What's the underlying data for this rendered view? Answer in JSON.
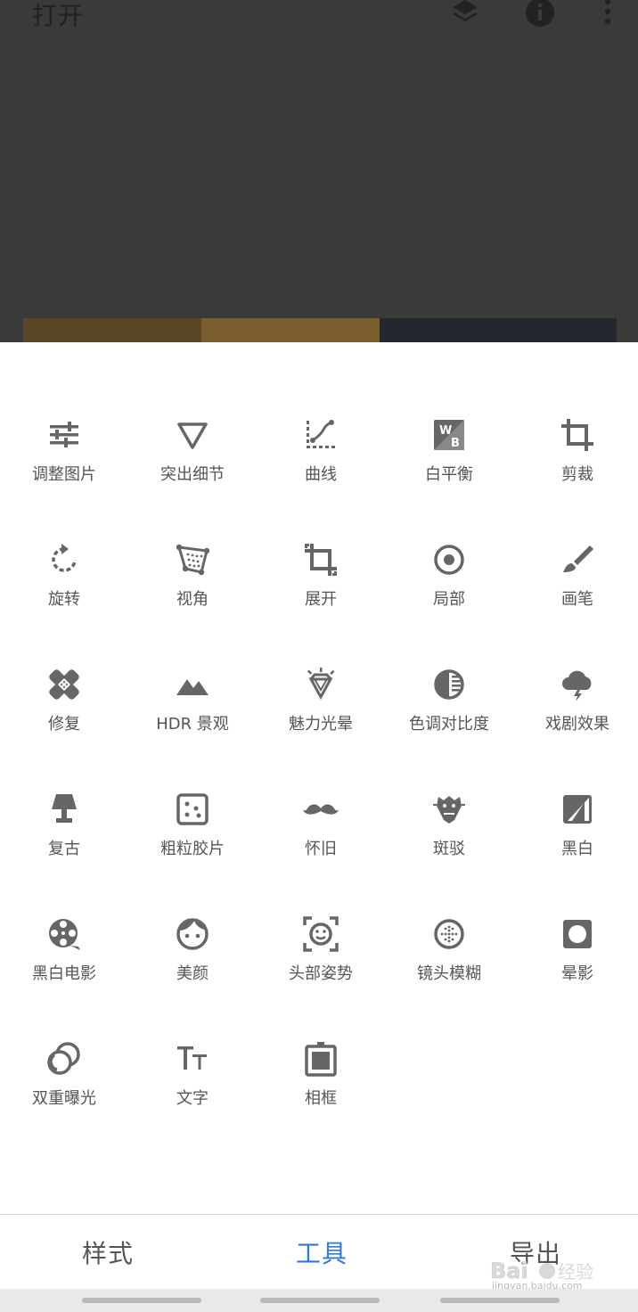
{
  "header": {
    "open_label": "打开"
  },
  "tools": [
    {
      "label": "调整图片",
      "icon": "tune-icon"
    },
    {
      "label": "突出细节",
      "icon": "details-triangle-icon"
    },
    {
      "label": "曲线",
      "icon": "curves-icon"
    },
    {
      "label": "白平衡",
      "icon": "white-balance-icon"
    },
    {
      "label": "剪裁",
      "icon": "crop-icon"
    },
    {
      "label": "旋转",
      "icon": "rotate-icon"
    },
    {
      "label": "视角",
      "icon": "perspective-icon"
    },
    {
      "label": "展开",
      "icon": "expand-icon"
    },
    {
      "label": "局部",
      "icon": "selective-icon"
    },
    {
      "label": "画笔",
      "icon": "brush-icon"
    },
    {
      "label": "修复",
      "icon": "healing-icon"
    },
    {
      "label": "HDR 景观",
      "icon": "hdr-mountain-icon"
    },
    {
      "label": "魅力光晕",
      "icon": "glamour-glow-diamond-icon"
    },
    {
      "label": "色调对比度",
      "icon": "tonal-contrast-icon"
    },
    {
      "label": "戏剧效果",
      "icon": "drama-cloud-icon"
    },
    {
      "label": "复古",
      "icon": "vintage-lamp-icon"
    },
    {
      "label": "粗粒胶片",
      "icon": "grainy-film-icon"
    },
    {
      "label": "怀旧",
      "icon": "mustache-icon"
    },
    {
      "label": "斑驳",
      "icon": "grunge-icon"
    },
    {
      "label": "黑白",
      "icon": "black-white-icon"
    },
    {
      "label": "黑白电影",
      "icon": "film-reel-icon"
    },
    {
      "label": "美颜",
      "icon": "face-icon"
    },
    {
      "label": "头部姿势",
      "icon": "head-pose-icon"
    },
    {
      "label": "镜头模糊",
      "icon": "lens-blur-icon"
    },
    {
      "label": "晕影",
      "icon": "vignette-icon"
    },
    {
      "label": "双重曝光",
      "icon": "double-exposure-icon"
    },
    {
      "label": "文字",
      "icon": "text-icon"
    },
    {
      "label": "相框",
      "icon": "frame-icon"
    }
  ],
  "tabs": [
    {
      "label": "样式",
      "active": false
    },
    {
      "label": "工具",
      "active": true
    },
    {
      "label": "导出",
      "active": false
    }
  ],
  "watermark": {
    "text": "jingyan.baidu.com"
  },
  "colors": {
    "icon": "#666666",
    "tab_active": "#2e7bd6",
    "tab_inactive": "#555555",
    "header_bg": "#3a3a3a"
  }
}
